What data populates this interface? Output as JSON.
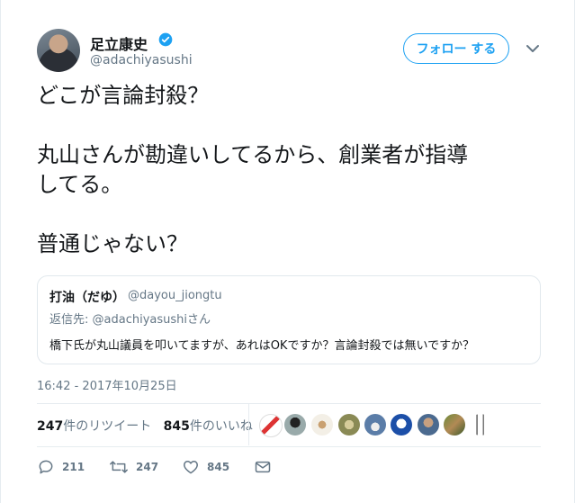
{
  "author": {
    "display_name": "足立康史",
    "handle": "@adachiyasushi",
    "verified": true
  },
  "follow_button": {
    "label": "フォロー する"
  },
  "tweet": {
    "text": "どこが言論封殺？\n\n丸山さんが勘違いしてるから、創業者が指導\nしてる。\n\n普通じゃない？"
  },
  "quoted_tweet": {
    "display_name": "打油（だゆ）",
    "handle": "@dayou_jiongtu",
    "reply_to": "返信先: @adachiyasushiさん",
    "text": "橋下氏が丸山議員を叩いてますが、あれはOKですか？言論封殺では無いですか？"
  },
  "timestamp": "16:42 - 2017年10月25日",
  "stats": {
    "retweets_count": "247",
    "retweets_label": "件のリツイート",
    "likes_count": "845",
    "likes_label": "件のいいね"
  },
  "actions": {
    "reply_count": "211",
    "retweet_count": "247",
    "like_count": "845"
  },
  "colors": {
    "accent": "#1da1f2",
    "secondary_text": "#657786",
    "border": "#e1e8ed"
  },
  "icons": [
    "verified-icon",
    "chevron-down-icon",
    "reply-icon",
    "retweet-icon",
    "like-icon",
    "message-icon"
  ]
}
